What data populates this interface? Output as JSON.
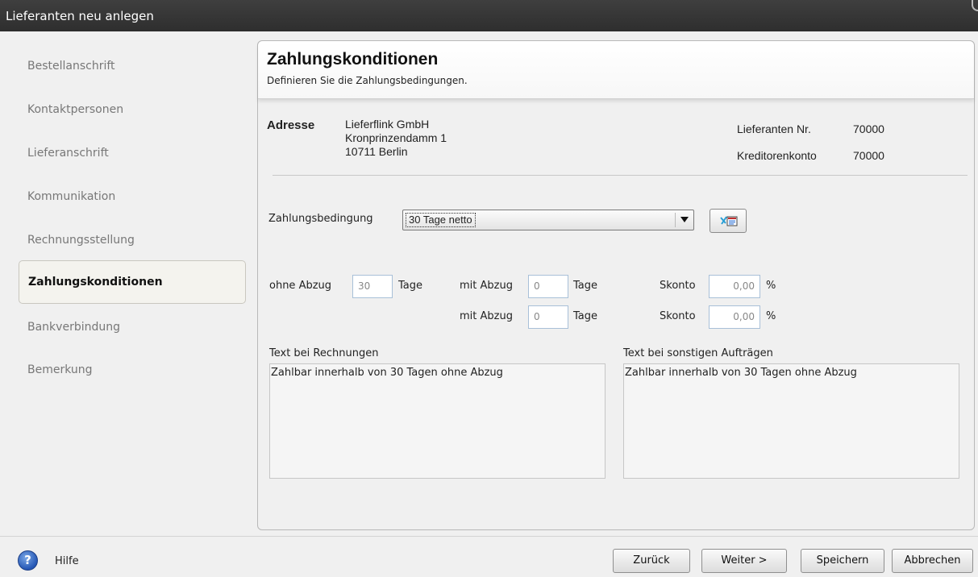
{
  "window": {
    "title": "Lieferanten neu anlegen"
  },
  "sidebar": {
    "items": [
      {
        "label": "Bestellanschrift"
      },
      {
        "label": "Kontaktpersonen"
      },
      {
        "label": "Lieferanschrift"
      },
      {
        "label": "Kommunikation"
      },
      {
        "label": "Rechnungsstellung"
      },
      {
        "label": "Zahlungskonditionen",
        "active": true
      },
      {
        "label": "Bankverbindung"
      },
      {
        "label": "Bemerkung"
      }
    ]
  },
  "panel": {
    "title": "Zahlungskonditionen",
    "subtitle": "Definieren Sie die Zahlungsbedingungen.",
    "address": {
      "label": "Adresse",
      "line1": "Lieferflink GmbH",
      "line2": "Kronprinzendamm 1",
      "line3": "10711 Berlin"
    },
    "supplier_no": {
      "label": "Lieferanten Nr.",
      "value": "70000"
    },
    "creditor_account": {
      "label": "Kreditorenkonto",
      "value": "70000"
    },
    "payment_term": {
      "label": "Zahlungsbedingung",
      "value": "30 Tage netto"
    },
    "without_deduction": {
      "label": "ohne Abzug",
      "value": "30",
      "unit": "Tage"
    },
    "discount_rows": [
      {
        "label": "mit Abzug",
        "days": "0",
        "unit": "Tage",
        "skonto_label": "Skonto",
        "skonto_value": "0,00",
        "percent": "%"
      },
      {
        "label": "mit Abzug",
        "days": "0",
        "unit": "Tage",
        "skonto_label": "Skonto",
        "skonto_value": "0,00",
        "percent": "%"
      }
    ],
    "invoice_text": {
      "label": "Text bei Rechnungen",
      "value": "Zahlbar innerhalb von 30 Tagen ohne Abzug"
    },
    "other_orders_text": {
      "label": "Text bei sonstigen Aufträgen",
      "value": "Zahlbar innerhalb von 30 Tagen ohne Abzug"
    }
  },
  "footer": {
    "help_label": "Hilfe",
    "back_label": "Zurück",
    "next_label": "Weiter >",
    "save_label": "Speichern",
    "cancel_label": "Abbrechen"
  },
  "icons": {
    "help": "help-icon",
    "dropdown": "chevron-down-icon",
    "edit_terms": "edit-payment-terms-icon"
  }
}
